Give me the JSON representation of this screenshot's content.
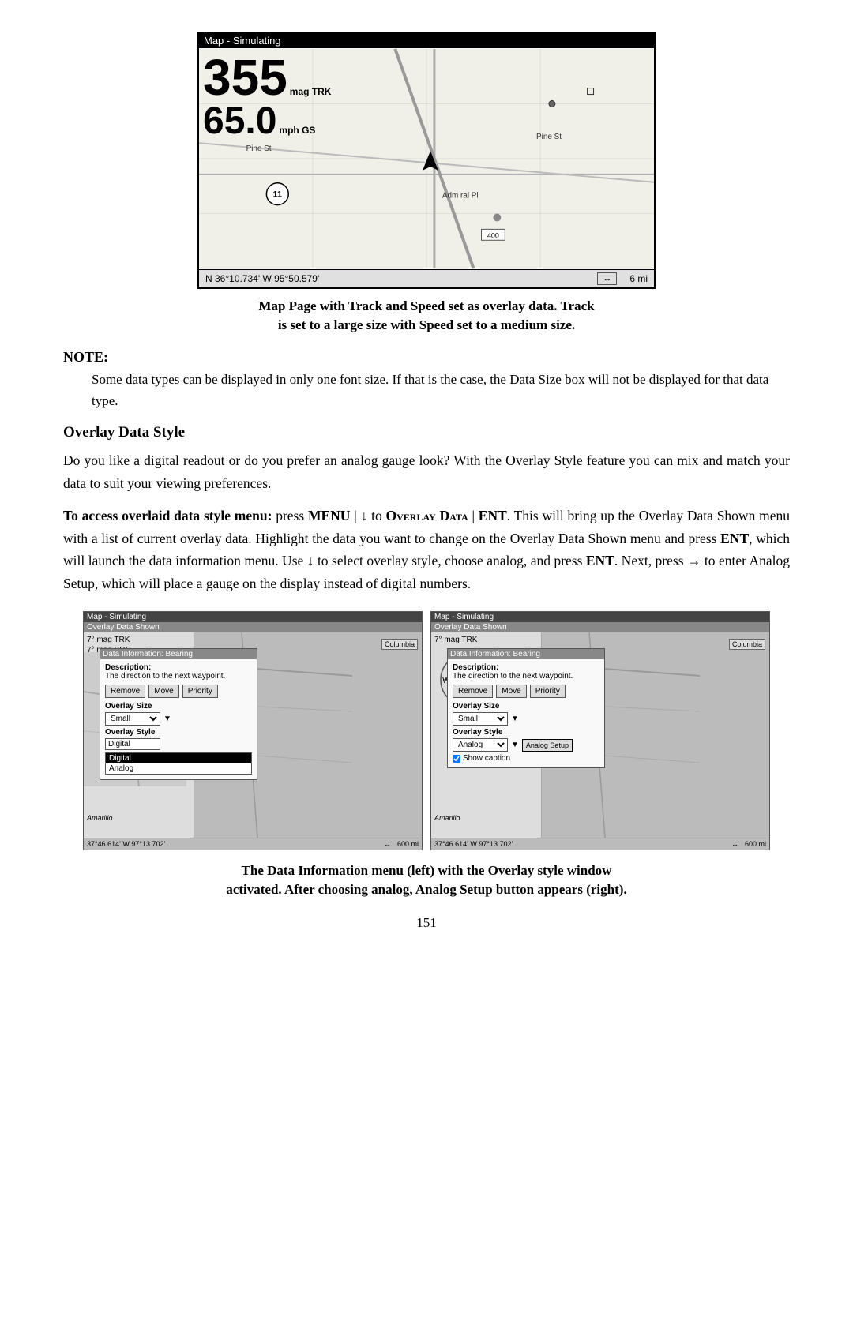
{
  "map_top": {
    "titlebar": "Map - Simulating",
    "track_number": "355",
    "track_label": "mag TRK",
    "speed_number": "65.0",
    "speed_label": "mph GS",
    "coords": "N  36°10.734'   W  95°50.579'",
    "scale": "6 mi",
    "caption_line1": "Map Page with Track and Speed set as overlay data. Track",
    "caption_line2": "is set to a large size with Speed set to a medium size."
  },
  "note": {
    "label": "NOTE:",
    "text": "Some data types can be displayed in only one font size. If that is the case, the Data Size box will not be displayed for that data type."
  },
  "overlay_section": {
    "heading": "Overlay Data Style",
    "para1": "Do you like a digital readout or do you prefer an analog gauge look? With the Overlay Style feature you can mix and match your data to suit your viewing preferences.",
    "para2_prefix": "To access overlaid data style menu:",
    "para2_main": " press MENU | ↓ to OVERLAY DATA | ENT. This will bring up the Overlay Data Shown menu with a list of current overlay data. Highlight the data you want to change on the Overlay Data Shown menu and press ENT, which will launch the data information menu. Use ↓ to select overlay style, choose analog, and press ENT. Next, press → to enter Analog Setup, which will place a gauge on the display instead of digital numbers."
  },
  "left_screenshot": {
    "titlebar": "Map - Simulating",
    "overlay_bar": "Overlay Data Shown",
    "trk_line": "7° mag TRK",
    "brg_line": "7° mag BRG",
    "panel_title": "Data Information: Bearing",
    "desc_label": "Description:",
    "desc_text": "The direction to the next waypoint.",
    "btn_remove": "Remove",
    "btn_move": "Move",
    "btn_priority": "Priority",
    "size_label": "Overlay Size",
    "size_value": "Small",
    "style_label": "Overlay Style",
    "style_value": "Digital",
    "dropdown_items": [
      "Digital",
      "Analog"
    ],
    "dropdown_selected": "Digital",
    "coords": "37°46.614'  W  97°13.702'",
    "scale": "600 mi",
    "place": "Amarillo"
  },
  "right_screenshot": {
    "titlebar": "Map - Simulating",
    "overlay_bar": "Overlay Data Shown",
    "trk_line": "7° mag TRK",
    "panel_title": "Data Information: Bearing",
    "desc_label": "Description:",
    "desc_text": "The direction to the next waypoint.",
    "btn_remove": "Remove",
    "btn_move": "Move",
    "btn_priority": "Priority",
    "size_label": "Overlay Size",
    "size_value": "Small",
    "style_label": "Overlay Style",
    "style_value": "Analog",
    "analog_setup_btn": "Analog Setup",
    "show_caption": "Show caption",
    "coords": "37°46.614'  W  97°13.702'",
    "scale": "600 mi",
    "place": "Amarillo"
  },
  "bottom_caption": {
    "line1": "The Data Information menu (left) with the Overlay style window",
    "line2": "activated. After choosing analog, Analog Setup button appears (right)."
  },
  "page_number": "151"
}
